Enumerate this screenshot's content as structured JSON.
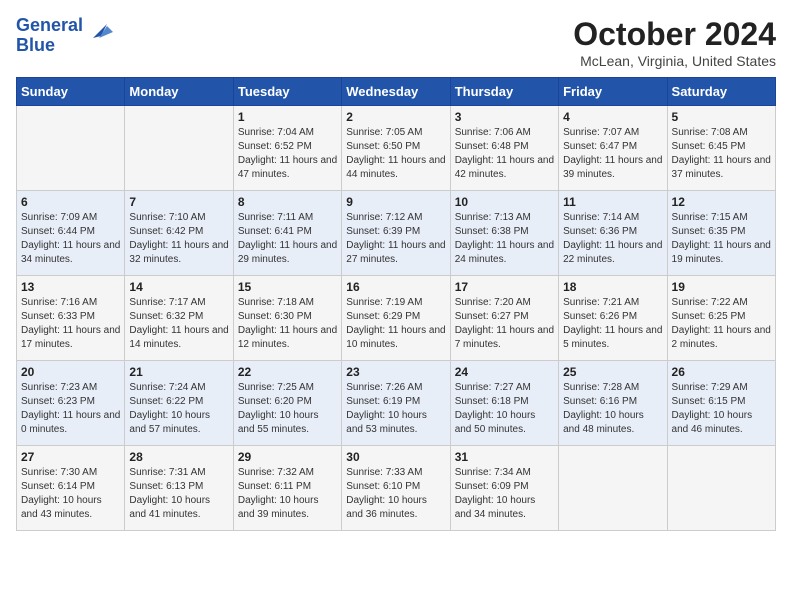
{
  "header": {
    "logo_line1": "General",
    "logo_line2": "Blue",
    "month": "October 2024",
    "location": "McLean, Virginia, United States"
  },
  "days_of_week": [
    "Sunday",
    "Monday",
    "Tuesday",
    "Wednesday",
    "Thursday",
    "Friday",
    "Saturday"
  ],
  "weeks": [
    [
      {
        "day": "",
        "info": ""
      },
      {
        "day": "",
        "info": ""
      },
      {
        "day": "1",
        "info": "Sunrise: 7:04 AM\nSunset: 6:52 PM\nDaylight: 11 hours and 47 minutes."
      },
      {
        "day": "2",
        "info": "Sunrise: 7:05 AM\nSunset: 6:50 PM\nDaylight: 11 hours and 44 minutes."
      },
      {
        "day": "3",
        "info": "Sunrise: 7:06 AM\nSunset: 6:48 PM\nDaylight: 11 hours and 42 minutes."
      },
      {
        "day": "4",
        "info": "Sunrise: 7:07 AM\nSunset: 6:47 PM\nDaylight: 11 hours and 39 minutes."
      },
      {
        "day": "5",
        "info": "Sunrise: 7:08 AM\nSunset: 6:45 PM\nDaylight: 11 hours and 37 minutes."
      }
    ],
    [
      {
        "day": "6",
        "info": "Sunrise: 7:09 AM\nSunset: 6:44 PM\nDaylight: 11 hours and 34 minutes."
      },
      {
        "day": "7",
        "info": "Sunrise: 7:10 AM\nSunset: 6:42 PM\nDaylight: 11 hours and 32 minutes."
      },
      {
        "day": "8",
        "info": "Sunrise: 7:11 AM\nSunset: 6:41 PM\nDaylight: 11 hours and 29 minutes."
      },
      {
        "day": "9",
        "info": "Sunrise: 7:12 AM\nSunset: 6:39 PM\nDaylight: 11 hours and 27 minutes."
      },
      {
        "day": "10",
        "info": "Sunrise: 7:13 AM\nSunset: 6:38 PM\nDaylight: 11 hours and 24 minutes."
      },
      {
        "day": "11",
        "info": "Sunrise: 7:14 AM\nSunset: 6:36 PM\nDaylight: 11 hours and 22 minutes."
      },
      {
        "day": "12",
        "info": "Sunrise: 7:15 AM\nSunset: 6:35 PM\nDaylight: 11 hours and 19 minutes."
      }
    ],
    [
      {
        "day": "13",
        "info": "Sunrise: 7:16 AM\nSunset: 6:33 PM\nDaylight: 11 hours and 17 minutes."
      },
      {
        "day": "14",
        "info": "Sunrise: 7:17 AM\nSunset: 6:32 PM\nDaylight: 11 hours and 14 minutes."
      },
      {
        "day": "15",
        "info": "Sunrise: 7:18 AM\nSunset: 6:30 PM\nDaylight: 11 hours and 12 minutes."
      },
      {
        "day": "16",
        "info": "Sunrise: 7:19 AM\nSunset: 6:29 PM\nDaylight: 11 hours and 10 minutes."
      },
      {
        "day": "17",
        "info": "Sunrise: 7:20 AM\nSunset: 6:27 PM\nDaylight: 11 hours and 7 minutes."
      },
      {
        "day": "18",
        "info": "Sunrise: 7:21 AM\nSunset: 6:26 PM\nDaylight: 11 hours and 5 minutes."
      },
      {
        "day": "19",
        "info": "Sunrise: 7:22 AM\nSunset: 6:25 PM\nDaylight: 11 hours and 2 minutes."
      }
    ],
    [
      {
        "day": "20",
        "info": "Sunrise: 7:23 AM\nSunset: 6:23 PM\nDaylight: 11 hours and 0 minutes."
      },
      {
        "day": "21",
        "info": "Sunrise: 7:24 AM\nSunset: 6:22 PM\nDaylight: 10 hours and 57 minutes."
      },
      {
        "day": "22",
        "info": "Sunrise: 7:25 AM\nSunset: 6:20 PM\nDaylight: 10 hours and 55 minutes."
      },
      {
        "day": "23",
        "info": "Sunrise: 7:26 AM\nSunset: 6:19 PM\nDaylight: 10 hours and 53 minutes."
      },
      {
        "day": "24",
        "info": "Sunrise: 7:27 AM\nSunset: 6:18 PM\nDaylight: 10 hours and 50 minutes."
      },
      {
        "day": "25",
        "info": "Sunrise: 7:28 AM\nSunset: 6:16 PM\nDaylight: 10 hours and 48 minutes."
      },
      {
        "day": "26",
        "info": "Sunrise: 7:29 AM\nSunset: 6:15 PM\nDaylight: 10 hours and 46 minutes."
      }
    ],
    [
      {
        "day": "27",
        "info": "Sunrise: 7:30 AM\nSunset: 6:14 PM\nDaylight: 10 hours and 43 minutes."
      },
      {
        "day": "28",
        "info": "Sunrise: 7:31 AM\nSunset: 6:13 PM\nDaylight: 10 hours and 41 minutes."
      },
      {
        "day": "29",
        "info": "Sunrise: 7:32 AM\nSunset: 6:11 PM\nDaylight: 10 hours and 39 minutes."
      },
      {
        "day": "30",
        "info": "Sunrise: 7:33 AM\nSunset: 6:10 PM\nDaylight: 10 hours and 36 minutes."
      },
      {
        "day": "31",
        "info": "Sunrise: 7:34 AM\nSunset: 6:09 PM\nDaylight: 10 hours and 34 minutes."
      },
      {
        "day": "",
        "info": ""
      },
      {
        "day": "",
        "info": ""
      }
    ]
  ]
}
